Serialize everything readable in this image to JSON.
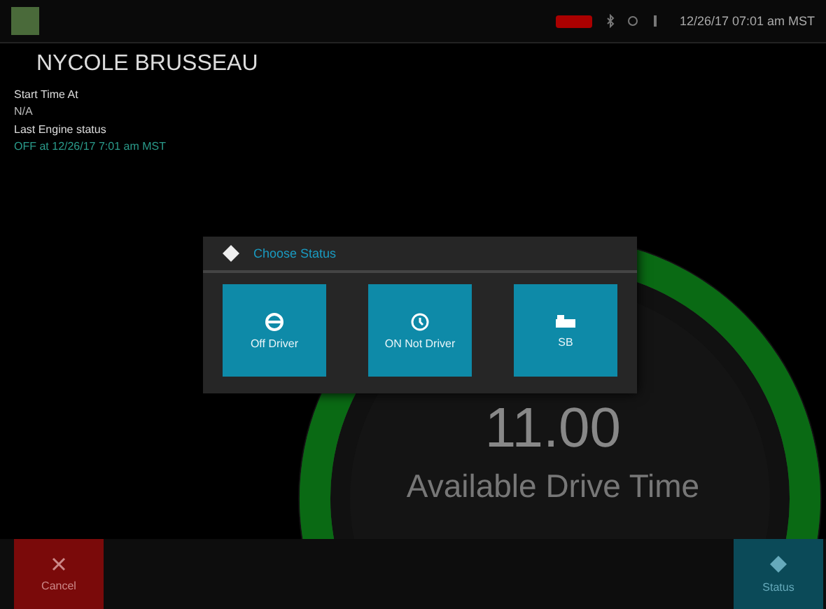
{
  "status_bar": {
    "time": "12/26/17 07:01 am MST"
  },
  "driver": {
    "name": "NYCOLE BRUSSEAU"
  },
  "fields": [
    {
      "label": "Start Time At",
      "value": "N/A",
      "kind": "plain"
    },
    {
      "label": "Last Engine status",
      "value": "OFF at 12/26/17 7:01 am MST",
      "kind": "engine"
    }
  ],
  "gauge": {
    "value": "11.00",
    "label": "Available Drive Time"
  },
  "dialog": {
    "title": "Choose Status",
    "options": [
      {
        "label": "Off Driver",
        "kind": "steering"
      },
      {
        "label": "ON Not Driver",
        "kind": "clock"
      },
      {
        "label": "SB",
        "kind": "bed"
      }
    ]
  },
  "footer": {
    "buttons": [
      {
        "label": "Cancel",
        "kind": "cancel"
      },
      {
        "label": "Status",
        "kind": "status"
      }
    ]
  }
}
